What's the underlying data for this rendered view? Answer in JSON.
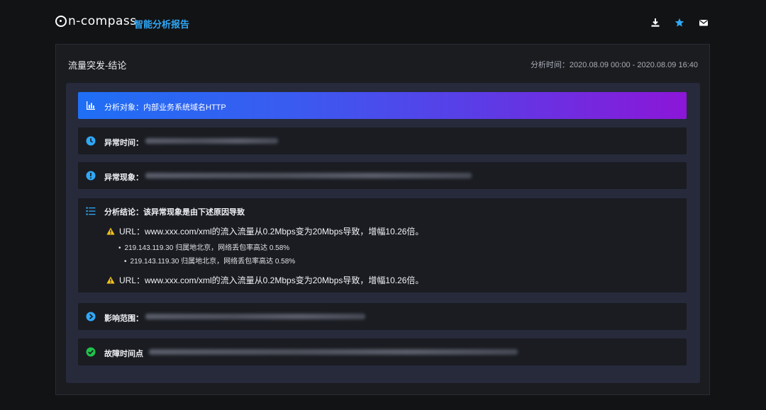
{
  "header": {
    "logo_text": "n-compass",
    "subtitle": "智能分析报告",
    "actions": [
      {
        "name": "download-icon"
      },
      {
        "name": "star-icon"
      },
      {
        "name": "mail-icon"
      }
    ]
  },
  "panel": {
    "title": "流量突发-结论",
    "time_range": "分析时间：2020.08.09  00:00 - 2020.08.09  16:40"
  },
  "rows": {
    "target": {
      "label": "分析对象：内部业务系统域名HTTP",
      "icon": "bar-chart-icon"
    },
    "abnormal_time": {
      "label": "异常时间：",
      "icon": "clock-icon"
    },
    "phenomenon": {
      "label": "异常现象：",
      "icon": "info-icon"
    },
    "conclusion": {
      "label": "分析结论：该异常现象是由下述原因导致",
      "icon": "list-icon",
      "url_1": "URL：www.xxx.com/xml的流入流量从0.2Mbps变为20Mbps导致，增幅10.26倍。",
      "ip_1": "219.143.119.30  归属地北京，网络丢包率高达 0.58%",
      "ip_2": "219.143.119.30  归属地北京，网络丢包率高达 0.58%",
      "url_2": "URL：www.xxx.com/xml的流入流量从0.2Mbps变为20Mbps导致，增幅10.26倍。"
    },
    "impact": {
      "label": "影响范围：",
      "icon": "chevron-right-circle-icon"
    },
    "fault_time": {
      "label": "故障时间点",
      "icon": "check-circle-icon"
    }
  },
  "colors": {
    "accent": "#2fa8f6",
    "target_gradient_start": "#1f6ff5",
    "target_gradient_end": "#8c16d8",
    "warning": "#f5c518",
    "success": "#1fc24a"
  }
}
